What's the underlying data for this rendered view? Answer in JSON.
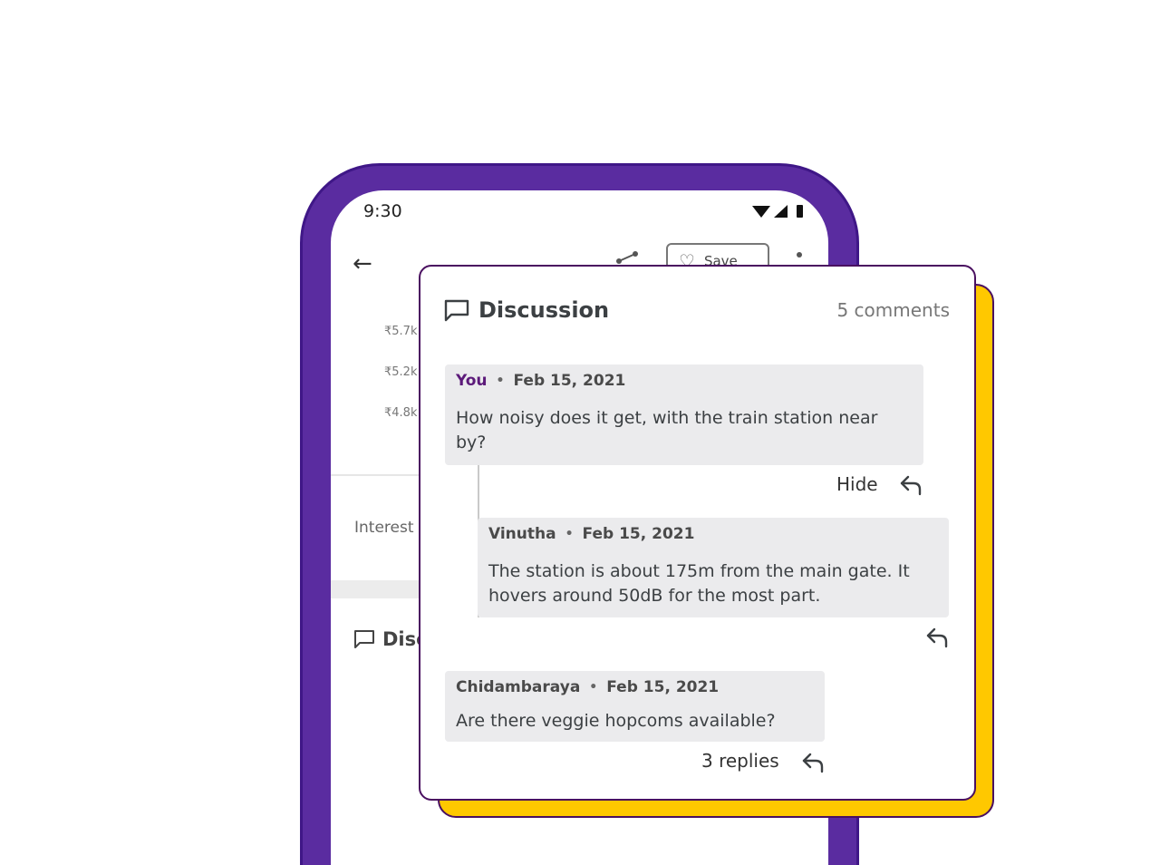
{
  "status_bar": {
    "time": "9:30"
  },
  "app_bar": {
    "save_label": "Save"
  },
  "background": {
    "prices": [
      "₹5.7k",
      "₹5.2k",
      "₹4.8k"
    ],
    "interested_label": "Interest",
    "discussion_label": "Disc"
  },
  "discussion": {
    "title": "Discussion",
    "count": "5 comments",
    "comments": [
      {
        "author": "You",
        "date": "Feb 15, 2021",
        "text": "How noisy does it get, with the  train station near by?",
        "action": "Hide"
      },
      {
        "author": "Vinutha",
        "date": "Feb 15, 2021",
        "text": "The station is about 175m from the main gate. It hovers around 50dB for the most part."
      },
      {
        "author": "Chidambaraya",
        "date": "Feb 15, 2021",
        "text": "Are there veggie hopcoms available?",
        "action": "3 replies"
      }
    ],
    "separator": "•"
  },
  "colors": {
    "phone_frame": "#5a2ca0",
    "card_shadow": "#ffc800",
    "card_border": "#4a1060",
    "author_you": "#5c1a7a",
    "bubble_bg": "#ebebed"
  }
}
